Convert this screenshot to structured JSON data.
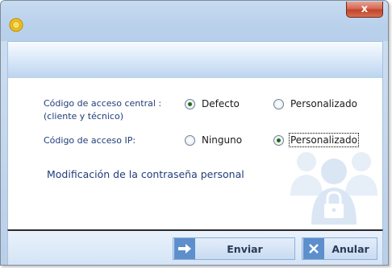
{
  "window": {
    "close_label": "x"
  },
  "form": {
    "row1_label_line1": "Código de acceso central :",
    "row1_label_line2": "(cliente y técnico)",
    "row1_options": [
      {
        "label": "Defecto",
        "selected": true
      },
      {
        "label": "Personalizado",
        "selected": false
      }
    ],
    "row2_label": "Código de acceso IP:",
    "row2_options": [
      {
        "label": "Ninguno",
        "selected": false
      },
      {
        "label": "Personalizado",
        "selected": true
      }
    ],
    "section_title": "Modificación de la contraseña personal"
  },
  "buttons": {
    "send_label": "Enviar",
    "cancel_label": "Anular"
  },
  "icons": {
    "app": "coin-icon",
    "users": "users-lock-icon",
    "send": "arrow-right-icon",
    "cancel": "x-icon"
  },
  "colors": {
    "accent": "#1f3d7a",
    "radio_selected": "#1d6b1d",
    "close_button": "#c2432c"
  }
}
